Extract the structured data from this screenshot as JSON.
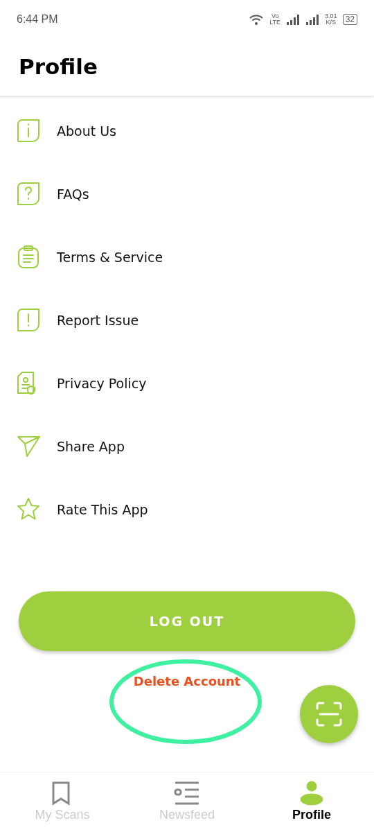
{
  "status_bar": {
    "time": "6:44 PM",
    "volte": [
      "Vo",
      "LTE"
    ],
    "speed": [
      "3.01",
      "K/S"
    ],
    "battery": "32"
  },
  "header": {
    "title": "Profile"
  },
  "menu": [
    {
      "kind": "info",
      "label": "About Us"
    },
    {
      "kind": "question",
      "label": "FAQs"
    },
    {
      "kind": "clipboard",
      "label": "Terms & Service"
    },
    {
      "kind": "alert",
      "label": "Report Issue"
    },
    {
      "kind": "document",
      "label": "Privacy Policy"
    },
    {
      "kind": "send",
      "label": "Share App"
    },
    {
      "kind": "star",
      "label": "Rate This App"
    }
  ],
  "logout_button": {
    "label": "LOG OUT"
  },
  "delete_account": {
    "label": "Delete Account",
    "circled": true
  },
  "bottom_nav": [
    {
      "kind": "bookmark",
      "label": "My Scans",
      "selected": false
    },
    {
      "kind": "list",
      "label": "Newsfeed",
      "selected": false
    },
    {
      "kind": "person",
      "label": "Profile",
      "selected": true
    }
  ]
}
